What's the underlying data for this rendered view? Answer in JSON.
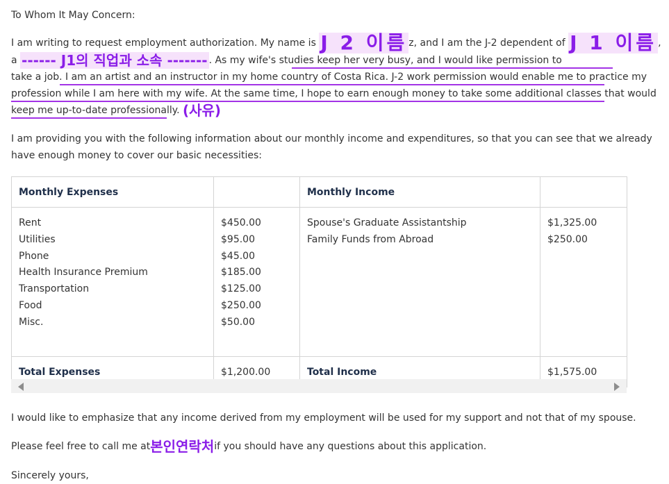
{
  "letter": {
    "salutation": "To Whom It May Concern:",
    "p1": {
      "a": "I am writing to request employment authorization. My name is ",
      "j2_name": "J 2 이름",
      "b": "z, and I am the J-2 dependent of ",
      "j1_name": "J 1 이름",
      "c": ",",
      "d": "a ",
      "j1_job": "------ J1의 직업과 소속 -------",
      "e": ". As my wife's studies keep her very busy, and I would like permission to",
      "f": "take a job. I am an artist and an instructor in my home country of Costa Rica. J-2 work permission would enable me to practice my",
      "g": "profession while I am here with my wife. At the same time, I hope to earn enough money to take some additional classes that would",
      "h": "keep me up-to-date professionally.",
      "reason": "(사유)"
    },
    "p2": {
      "line1": "I am providing you with the following information about our monthly income and expenditures, so that you can see that we already",
      "line2": "have enough money to cover our basic necessities:"
    },
    "p3": "I would like to emphasize that any income derived from my employment will be used for my support and not that of my spouse.",
    "p4": {
      "a": "Please feel free to call me at",
      "contact": "본인연락처",
      "b": "if you should have any questions about this application."
    },
    "closing": "Sincerely yours,"
  },
  "table": {
    "expenses_header": "Monthly Expenses",
    "income_header": "Monthly Income",
    "expenses": [
      {
        "item": "Rent",
        "amount": "$450.00"
      },
      {
        "item": "Utilities",
        "amount": "$95.00"
      },
      {
        "item": "Phone",
        "amount": "$45.00"
      },
      {
        "item": "Health Insurance Premium",
        "amount": "$185.00"
      },
      {
        "item": "Transportation",
        "amount": "$125.00"
      },
      {
        "item": "Food",
        "amount": "$250.00"
      },
      {
        "item": "Misc.",
        "amount": "$50.00"
      }
    ],
    "income": [
      {
        "item": "Spouse's Graduate Assistantship",
        "amount": "$1,325.00"
      },
      {
        "item": "Family Funds from Abroad",
        "amount": "$250.00"
      }
    ],
    "total_expenses_label": "Total Expenses",
    "total_expenses": "$1,200.00",
    "total_income_label": "Total Income",
    "total_income": "$1,575.00"
  },
  "colors": {
    "highlight_text": "#8a1de8",
    "highlight_bg": "#f6e2fb",
    "underline": "#a333e6"
  },
  "icons": [
    "scroll-left-arrow-icon",
    "scroll-right-arrow-icon"
  ]
}
